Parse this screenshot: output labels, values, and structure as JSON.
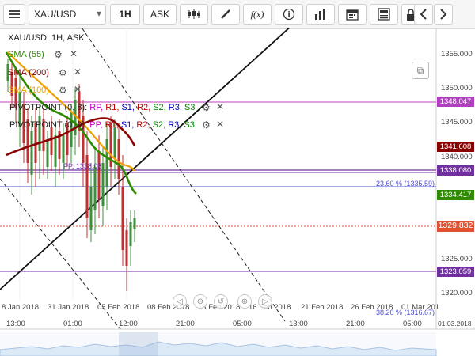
{
  "toolbar": {
    "menu_icon": "hamburger-icon",
    "symbol": "XAU/USD",
    "symbol_arrow": "▾",
    "timeframe": "1H",
    "price_type": "ASK",
    "fx_label": "f(x)"
  },
  "chart": {
    "header": "XAU/USD, 1H, ASK",
    "indicators": [
      {
        "label": "SMA (55)",
        "color": "#2e8b00"
      },
      {
        "label": "SMA (200)",
        "color": "#8b0000"
      },
      {
        "label": "SMA (100)",
        "color": "#f0a000"
      }
    ],
    "pivot_1": {
      "name": "PIVOTPOINT (0, 8)",
      "sep": ": ",
      "items": [
        "RP,",
        "R1,",
        "S1,",
        "R2,",
        "S2,",
        "R3,",
        "S3"
      ]
    },
    "pivot_2": {
      "name": "PIVOTPOINT (0, 9)",
      "sep": ": ",
      "items": [
        "PP,",
        "R1,",
        "S1,",
        "R2,",
        "S2,",
        "R3,",
        "S3"
      ]
    },
    "pivot_item_colors": [
      "#c000c0",
      "#c00000",
      "#0000c0",
      "#c00000",
      "#008000",
      "#0000c0",
      "#008000"
    ],
    "pp_label": "PP, 1338.08",
    "fib_label_1": "23.60 % (1335.59)",
    "fib_label_2": "38.20 % (1316.67)",
    "price_axis": [
      "1355.000",
      "1350.000",
      "1345.000",
      "1340.000",
      "1325.000",
      "1320.000"
    ],
    "price_tags": [
      {
        "value": "1348.047",
        "color": "#b040c0"
      },
      {
        "value": "1341.608",
        "color": "#8b0000"
      },
      {
        "value": "1338.080",
        "color": "#7030a0"
      },
      {
        "value": "1334.417",
        "color": "#2e8b00"
      },
      {
        "value": "1329.832",
        "color": "#e05030"
      },
      {
        "value": "1323.059",
        "color": "#7030a0"
      }
    ],
    "date_axis": [
      "8 Jan 2018",
      "31 Jan 2018",
      "05 Feb 2018",
      "08 Feb 2018",
      "13 Feb 2018",
      "16 Feb 2018",
      "21 Feb 2018",
      "26 Feb 2018",
      "01 Mar 201"
    ],
    "time_axis": [
      "13:00",
      "01:00",
      "12:00",
      "21:00",
      "05:00",
      "13:00",
      "21:00",
      "05:00",
      "01.03.2018"
    ]
  }
}
